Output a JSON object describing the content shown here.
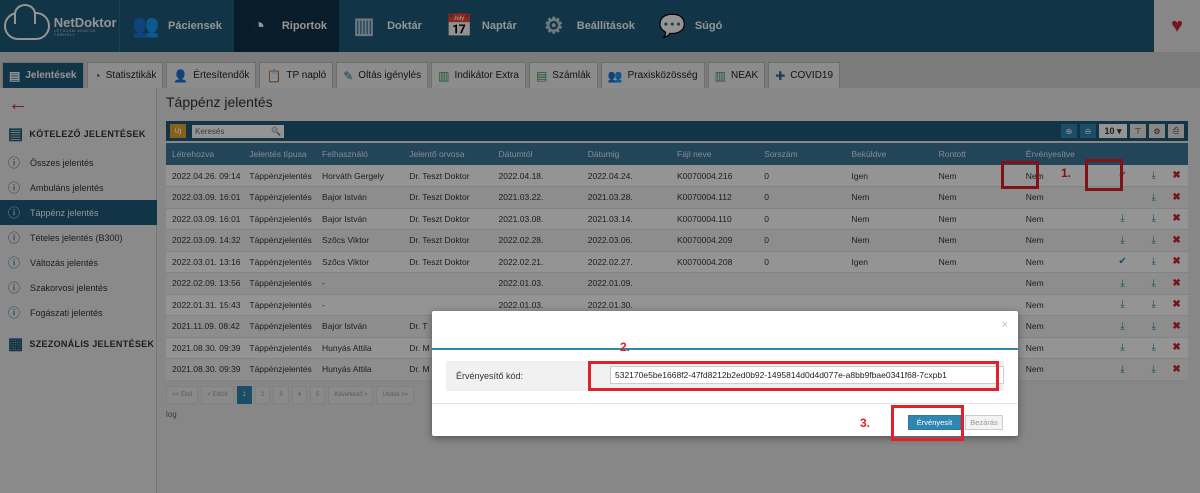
{
  "logo": {
    "name": "NetDoktor",
    "tagline": "LÉTSZÁM ADATOK TÁRHELY"
  },
  "nav": [
    {
      "label": "Páciensek",
      "icon": "👥"
    },
    {
      "label": "Riportok",
      "icon": "◔"
    },
    {
      "label": "Doktár",
      "icon": "▥"
    },
    {
      "label": "Naptár",
      "icon": "📅"
    },
    {
      "label": "Beállítások",
      "icon": "⚙"
    },
    {
      "label": "Súgó",
      "icon": "💬"
    }
  ],
  "nav_right_icon": "♥",
  "tabs": [
    {
      "label": "Jelentések",
      "icon": "▤"
    },
    {
      "label": "Statisztikák",
      "icon": "◔"
    },
    {
      "label": "Értesítendők",
      "icon": "👤"
    },
    {
      "label": "TP napló",
      "icon": "📋"
    },
    {
      "label": "Oltás igénylés",
      "icon": "✎"
    },
    {
      "label": "Indikátor Extra",
      "icon": "▥"
    },
    {
      "label": "Számlák",
      "icon": "▤"
    },
    {
      "label": "Praxisközösség",
      "icon": "👥"
    },
    {
      "label": "NEAK",
      "icon": "▥"
    },
    {
      "label": "COVID19",
      "icon": "✚"
    }
  ],
  "sidebar": {
    "back_icon": "←",
    "section1": {
      "label": "KÖTELEZŐ JELENTÉSEK",
      "icon": "▤"
    },
    "items": [
      {
        "label": "Összes jelentés",
        "icon": "ⓘ"
      },
      {
        "label": "Ambuláns jelentés",
        "icon": "ⓘ"
      },
      {
        "label": "Táppénz jelentés",
        "icon": "ⓘ"
      },
      {
        "label": "Tételes jelentés (B300)",
        "icon": "ⓘ"
      },
      {
        "label": "Változás jelentés",
        "icon": "ⓘ"
      },
      {
        "label": "Szakorvosi jelentés",
        "icon": "ⓘ"
      },
      {
        "label": "Fogászati jelentés",
        "icon": "ⓘ"
      }
    ],
    "section2": {
      "label": "SZEZONÁLIS JELENTÉSEK",
      "icon": "▦"
    }
  },
  "page": {
    "title": "Táppénz jelentés"
  },
  "toolbar": {
    "filter_label": "Új",
    "search_placeholder": "Keresés",
    "search_icon": "🔍",
    "page_size": "10",
    "btn_icons": [
      "⊕",
      "⊖",
      "⊤",
      "⚙",
      "⎙"
    ]
  },
  "table": {
    "headers": [
      "Létrehozva",
      "Jelentés típusa",
      "Felhasználó",
      "Jelentő orvosa",
      "Dátumtól",
      "Dátumig",
      "Fájl neve",
      "Sorszám",
      "Beküldve",
      "Rontott",
      "Érvényesítve",
      "",
      "",
      ""
    ],
    "rows": [
      [
        "2022.04.26. 09:14",
        "Táppénzjelentés",
        "Horváth Gergely",
        "Dr. Teszt Doktor",
        "2022.04.18.",
        "2022.04.24.",
        "K0070004.216",
        "0",
        "Igen",
        "Nem",
        "Nem",
        "✔",
        "⤓",
        "✖"
      ],
      [
        "2022.03.09. 16:01",
        "Táppénzjelentés",
        "Bajor István",
        "Dr. Teszt Doktor",
        "2021.03.22.",
        "2021.03.28.",
        "K0070004.112",
        "0",
        "Nem",
        "Nem",
        "Nem",
        "",
        "⤓",
        "✖"
      ],
      [
        "2022.03.09. 16:01",
        "Táppénzjelentés",
        "Bajor István",
        "Dr. Teszt Doktor",
        "2021.03.08.",
        "2021.03.14.",
        "K0070004.110",
        "0",
        "Nem",
        "Nem",
        "Nem",
        "⤓",
        "⤓",
        "✖"
      ],
      [
        "2022.03.09. 14:32",
        "Táppénzjelentés",
        "Szőcs Viktor",
        "Dr. Teszt Doktor",
        "2022.02.28.",
        "2022.03.06.",
        "K0070004.209",
        "0",
        "Nem",
        "Nem",
        "Nem",
        "⤓",
        "⤓",
        "✖"
      ],
      [
        "2022.03.01. 13:16",
        "Táppénzjelentés",
        "Szőcs Viktor",
        "Dr. Teszt Doktor",
        "2022.02.21.",
        "2022.02.27.",
        "K0070004.208",
        "0",
        "Igen",
        "Nem",
        "Nem",
        "✔",
        "⤓",
        "✖"
      ],
      [
        "2022.02.09. 13:56",
        "Táppénzjelentés",
        "-",
        "",
        "2022.01.03.",
        "2022.01.09.",
        "",
        "",
        "",
        "",
        "Nem",
        "⤓",
        "⤓",
        "✖"
      ],
      [
        "2022.01.31. 15:43",
        "Táppénzjelentés",
        "-",
        "",
        "2022.01.03.",
        "2022.01.30.",
        "",
        "",
        "",
        "",
        "Nem",
        "⤓",
        "⤓",
        "✖"
      ],
      [
        "2021.11.09. 08:42",
        "Táppénzjelentés",
        "Bajor István",
        "Dr. T",
        "",
        "",
        "",
        "",
        "",
        "",
        "Nem",
        "⤓",
        "⤓",
        "✖"
      ],
      [
        "2021.08.30. 09:39",
        "Táppénzjelentés",
        "Hunyás Attila",
        "Dr. M",
        "",
        "",
        "",
        "",
        "",
        "",
        "Nem",
        "⤓",
        "⤓",
        "✖"
      ],
      [
        "2021.08.30. 09:39",
        "Táppénzjelentés",
        "Hunyás Attila",
        "Dr. M",
        "",
        "",
        "",
        "",
        "",
        "",
        "Nem",
        "⤓",
        "⤓",
        "✖"
      ]
    ]
  },
  "pagination": {
    "first": "<< Első",
    "prev": "< Előző",
    "pages": [
      "1",
      "2",
      "3",
      "4",
      "5"
    ],
    "next": "Következő >",
    "last": "Utolsó >>"
  },
  "log_label": "log",
  "modal": {
    "close_icon": "×",
    "label": "Érvényesítő kód:",
    "value": "532170e5be1668f2-47fd8212b2ed0b92-1495814d0d4d077e-a8bb9fbae0341f68-7cxpb1",
    "primary_label": "Érvényesít",
    "secondary_label": "Bezárás"
  },
  "annotations": {
    "step1": "1.",
    "step2": "2.",
    "step3": "3."
  },
  "colors": {
    "nav": "#1f5a7a",
    "accent": "#2f86b1",
    "annotation": "#e0202a",
    "danger": "#c8282d"
  }
}
